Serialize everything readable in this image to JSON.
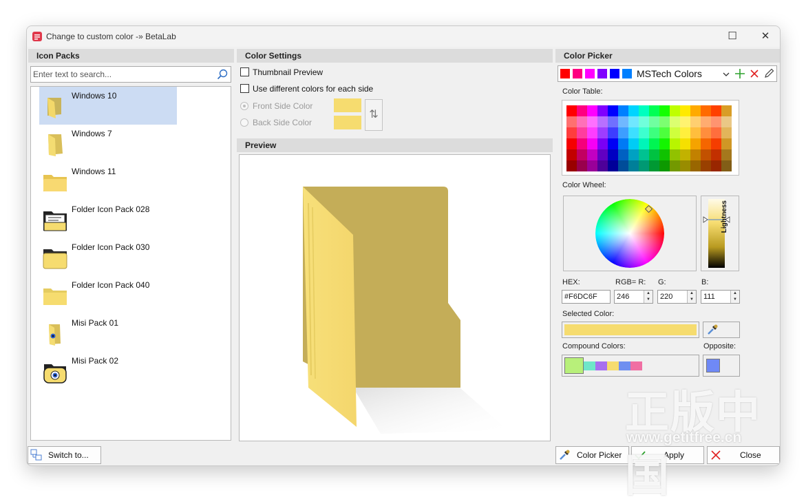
{
  "window": {
    "title": "Change to custom color -» BetaLab",
    "minimize": "☐",
    "close": "✕"
  },
  "icon_packs": {
    "header": "Icon Packs",
    "search_placeholder": "Enter text to search...",
    "items": [
      {
        "label": "Windows 10",
        "icon": "folder-win10-icon",
        "selected": true
      },
      {
        "label": "Windows 7",
        "icon": "folder-win7-icon",
        "selected": false
      },
      {
        "label": "Windows 11",
        "icon": "folder-win11-icon",
        "selected": false
      },
      {
        "label": "Folder Icon Pack 028",
        "icon": "folder-document-icon",
        "selected": false
      },
      {
        "label": "Folder Icon Pack 030",
        "icon": "folder-dark-tab-icon",
        "selected": false
      },
      {
        "label": "Folder Icon Pack 040",
        "icon": "folder-flat-icon",
        "selected": false
      },
      {
        "label": "Misi Pack 01",
        "icon": "folder-eye-icon",
        "selected": false
      },
      {
        "label": "Misi Pack 02",
        "icon": "folder-eye-round-icon",
        "selected": false
      }
    ]
  },
  "color_settings": {
    "header": "Color Settings",
    "thumbnail_preview": "Thumbnail Preview",
    "different_colors": "Use different colors for each side",
    "front_side": "Front Side Color",
    "back_side": "Back Side Color",
    "swap_glyph": "⇅"
  },
  "preview": {
    "header": "Preview"
  },
  "color_picker": {
    "header": "Color Picker",
    "palette_name": "MSTech Colors",
    "palette_swatches": [
      "#ff0000",
      "#ff0080",
      "#ff00ff",
      "#8000ff",
      "#0000ff",
      "#0080ff"
    ],
    "color_table_label": "Color Table:",
    "color_wheel_label": "Color Wheel:",
    "lightness_label": "Lightness",
    "hex_label": "HEX:",
    "rgb_label": "RGB= R:",
    "g_label": "G:",
    "b_label": "B:",
    "hex_value": "#F6DC6F",
    "r_value": "246",
    "g_value": "220",
    "b_value": "111",
    "selected_color_label": "Selected Color:",
    "selected_color": "#f6dc6f",
    "compound_colors_label": "Compound Colors:",
    "compound_colors": [
      "#b8f07a",
      "#6fe6c8",
      "#a86ff0",
      "#f6dc6f",
      "#6f8ff0",
      "#f06fa3"
    ],
    "opposite_label": "Opposite:",
    "opposite_color": "#6f89f6"
  },
  "footer": {
    "switch_to": "Switch to...",
    "color_picker": "Color Picker",
    "apply": "Apply",
    "close": "Close"
  },
  "watermark": {
    "cn": "正版中国",
    "url": "www.getitfree.cn"
  }
}
